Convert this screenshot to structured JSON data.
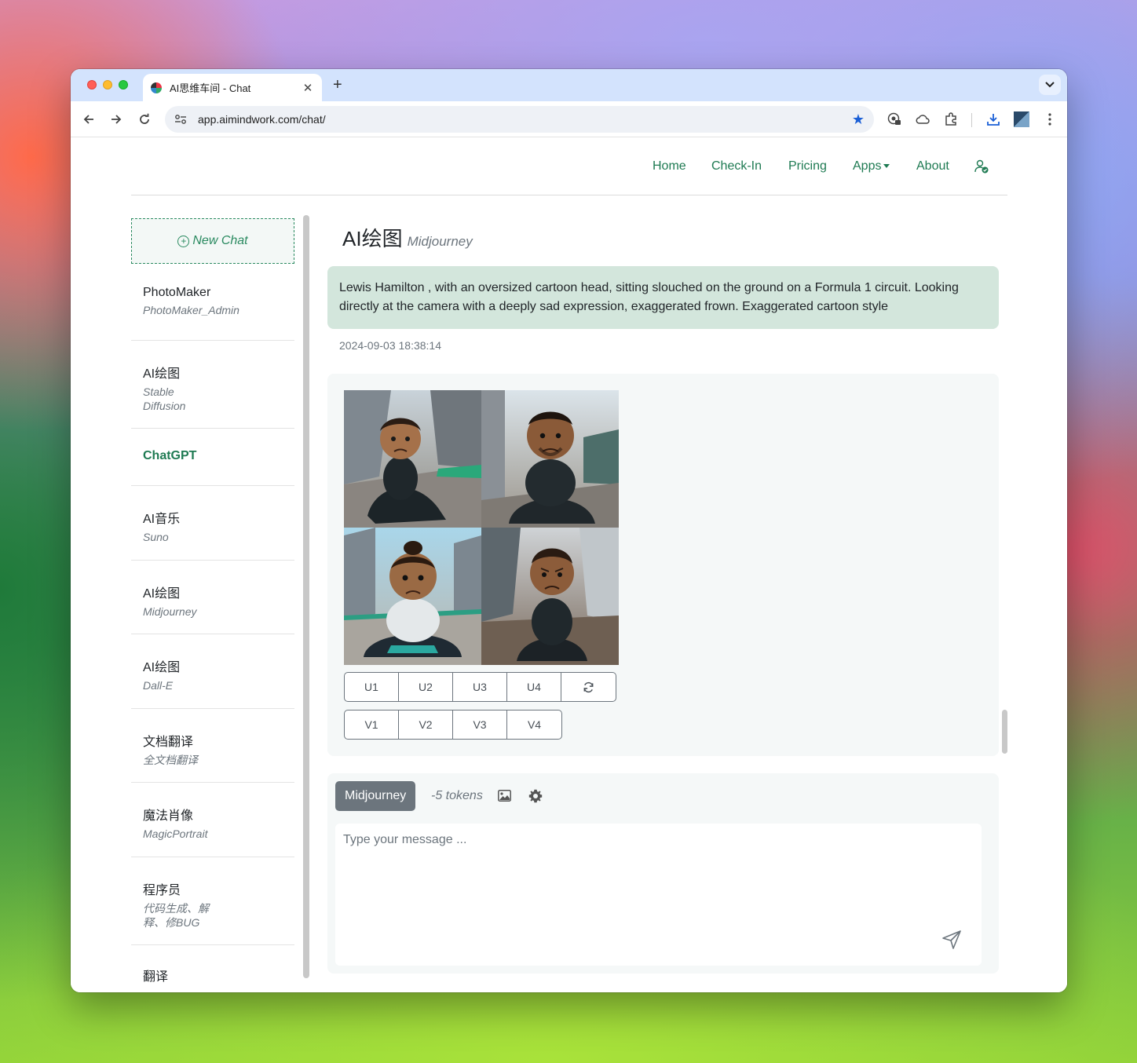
{
  "browser": {
    "tab_title": "AI思维车间 - Chat",
    "new_tab": "+",
    "url": "app.aimindwork.com/chat/"
  },
  "nav": {
    "home": "Home",
    "checkin": "Check-In",
    "pricing": "Pricing",
    "apps": "Apps",
    "about": "About"
  },
  "sidebar": {
    "new_chat": "New Chat",
    "items": [
      {
        "title": "PhotoMaker",
        "sub": "PhotoMaker_Admin"
      },
      {
        "title": "AI绘图",
        "sub": "Stable Diffusion"
      },
      {
        "title": "ChatGPT",
        "sub": ""
      },
      {
        "title": "AI音乐",
        "sub": "Suno"
      },
      {
        "title": "AI绘图",
        "sub": "Midjourney"
      },
      {
        "title": "AI绘图",
        "sub": "Dall-E"
      },
      {
        "title": "文档翻译",
        "sub": "全文档翻译"
      },
      {
        "title": "魔法肖像",
        "sub": "MagicPortrait"
      },
      {
        "title": "程序员",
        "sub": "代码生成、解释、修BUG"
      },
      {
        "title": "翻译",
        "sub": ""
      }
    ]
  },
  "main": {
    "title": "AI绘图",
    "subtitle": "Midjourney",
    "prompt": "Lewis Hamilton , with an oversized cartoon head, sitting slouched on the ground on a Formula 1 circuit. Looking directly at the camera with a deeply sad expression, exaggerated frown. Exaggerated cartoon style",
    "timestamp": "2024-09-03 18:38:14",
    "upscale_buttons": [
      "U1",
      "U2",
      "U3",
      "U4"
    ],
    "variation_buttons": [
      "V1",
      "V2",
      "V3",
      "V4"
    ]
  },
  "composer": {
    "model": "Midjourney",
    "tokens": "-5 tokens",
    "placeholder": "Type your message ..."
  },
  "colors": {
    "accent": "#1e7a52",
    "prompt_bg": "#d3e6dc",
    "badge_bg": "#6c757d",
    "tabbar": "#d3e3fd"
  }
}
